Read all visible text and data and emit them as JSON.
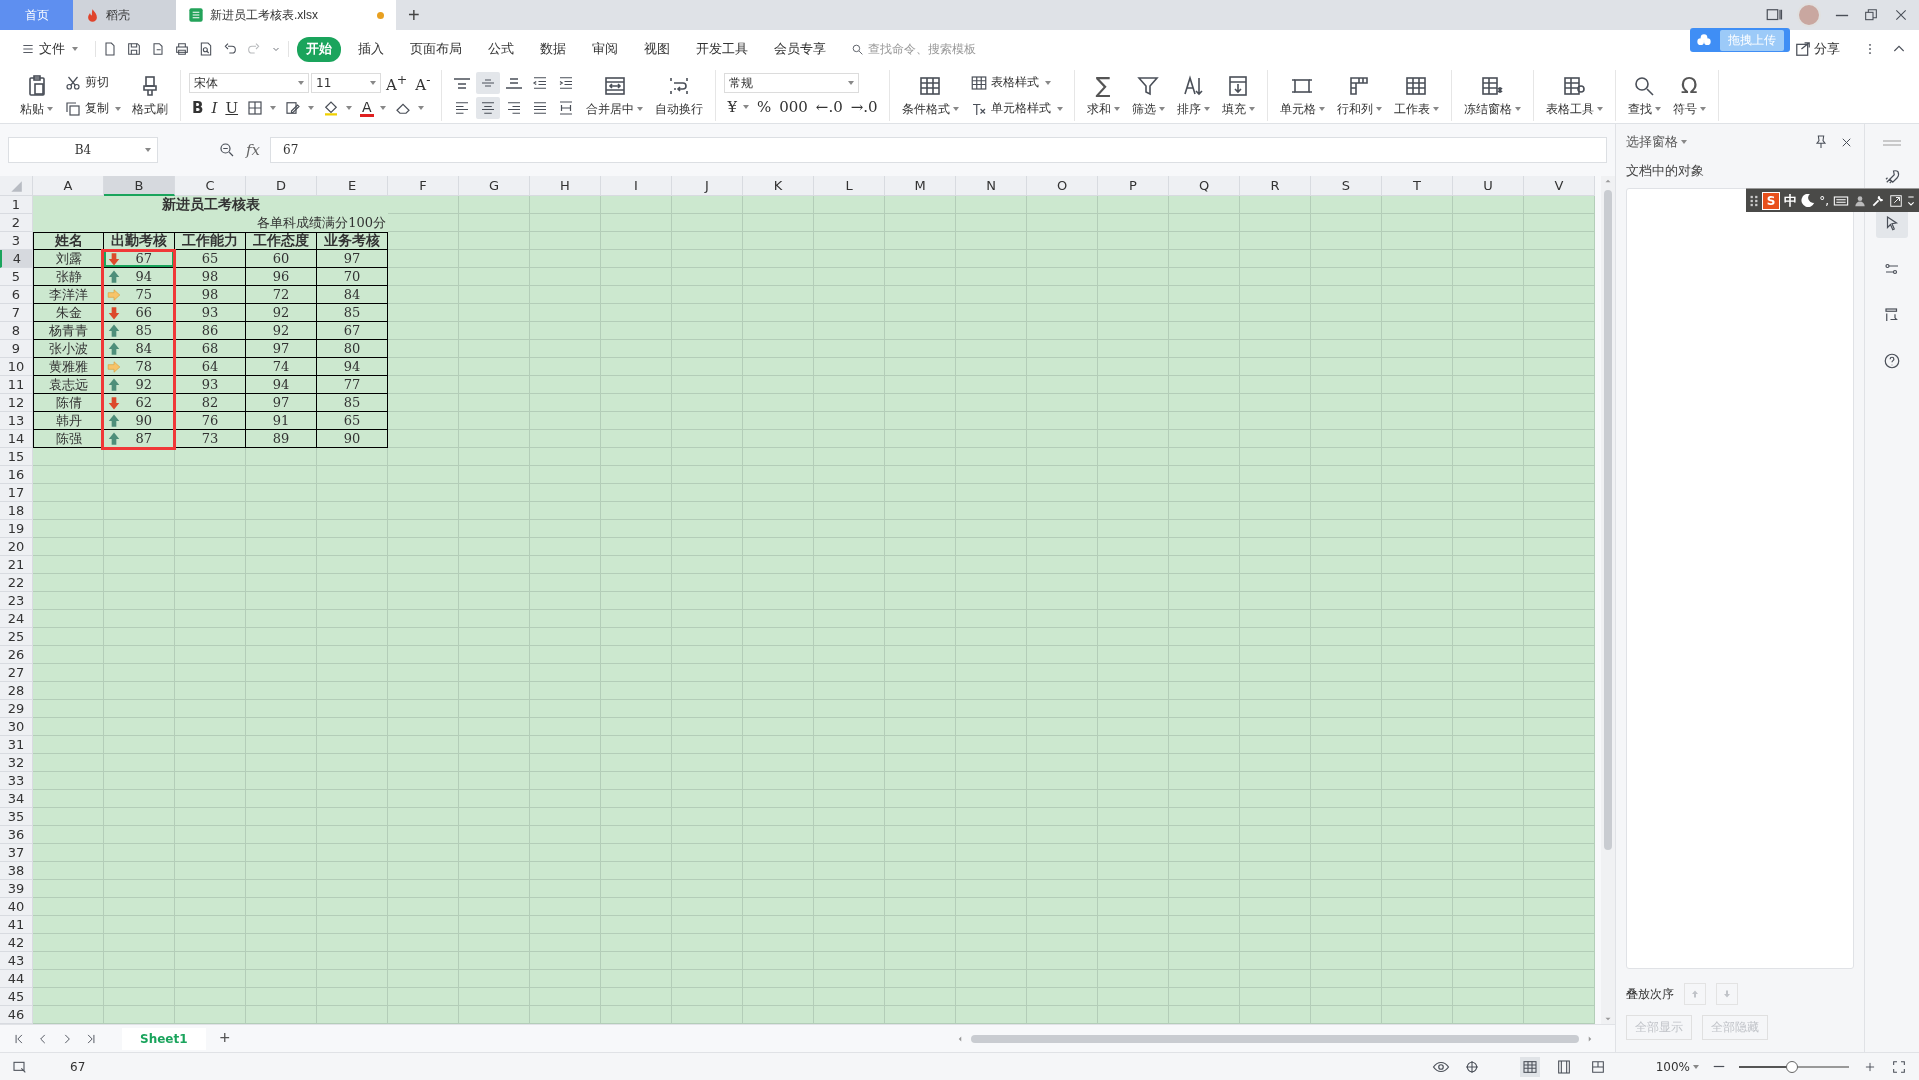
{
  "tabs": [
    {
      "label": "首页",
      "kind": "home",
      "selected": false
    },
    {
      "label": "稻壳",
      "kind": "docer",
      "selected": false
    },
    {
      "label": "新进员工考核表.xlsx",
      "kind": "workbook",
      "selected": true,
      "modified": true
    }
  ],
  "new_tab": "+",
  "menu": {
    "file": "文件",
    "tabs": [
      {
        "label": "开始",
        "selected": true
      },
      {
        "label": "插入",
        "selected": false
      },
      {
        "label": "页面布局",
        "selected": false
      },
      {
        "label": "公式",
        "selected": false
      },
      {
        "label": "数据",
        "selected": false
      },
      {
        "label": "审阅",
        "selected": false
      },
      {
        "label": "视图",
        "selected": false
      },
      {
        "label": "开发工具",
        "selected": false
      },
      {
        "label": "会员专享",
        "selected": false
      }
    ],
    "search": {
      "placeholder": "查找命令、搜索模板"
    },
    "upload_popup": "拖拽上传",
    "share": "分享"
  },
  "ribbon": [
    {
      "blocks": [
        {
          "kind": "big",
          "item": {
            "kind": "paste",
            "label": "粘贴",
            "dropdown": true
          }
        },
        {
          "kind": "stack",
          "items": [
            {
              "kind": "cut",
              "label": "剪切"
            },
            {
              "kind": "copy",
              "label": "复制",
              "dropdown": true
            }
          ]
        },
        {
          "kind": "big",
          "item": {
            "kind": "brush",
            "label": "格式刷"
          }
        }
      ]
    },
    {
      "blocks": [
        {
          "kind": "rows",
          "rows": [
            {
              "items": [
                {
                  "kind": "font-select",
                  "value": "宋体"
                },
                {
                  "kind": "size-select",
                  "value": "11"
                },
                {
                  "kind": "glyph",
                  "text": "A$^{+}$"
                },
                {
                  "kind": "glyph",
                  "text": "A$^{-}$"
                }
              ]
            },
            {
              "items": [
                {
                  "kind": "bold",
                  "text": "B"
                },
                {
                  "kind": "italic",
                  "text": "I"
                },
                {
                  "kind": "underline",
                  "text": "U"
                },
                {
                  "kind": "border",
                  "dropdown": true
                },
                {
                  "kind": "cellformat",
                  "dropdown": true
                },
                {
                  "kind": "fill",
                  "dropdown": true
                },
                {
                  "kind": "fontcolor",
                  "text": "A",
                  "dropdown": true
                },
                {
                  "kind": "eraser",
                  "dropdown": true
                }
              ]
            }
          ]
        }
      ]
    },
    {
      "blocks": [
        {
          "kind": "rows",
          "rows": [
            {
              "items": [
                {
                  "kind": "align-top",
                  "selected": false
                },
                {
                  "kind": "align-middle",
                  "selected": true
                },
                {
                  "kind": "align-bottom",
                  "selected": false
                },
                {
                  "kind": "indent-dec",
                  "selected": false
                },
                {
                  "kind": "indent-inc",
                  "selected": false
                }
              ]
            },
            {
              "items": [
                {
                  "kind": "align-left",
                  "selected": false
                },
                {
                  "kind": "align-center",
                  "selected": true
                },
                {
                  "kind": "align-right",
                  "selected": false
                },
                {
                  "kind": "justify",
                  "selected": false
                },
                {
                  "kind": "distributed",
                  "selected": false
                }
              ]
            }
          ]
        },
        {
          "kind": "big",
          "item": {
            "kind": "merge",
            "label": "合并居中",
            "dropdown": true
          }
        },
        {
          "kind": "big",
          "item": {
            "kind": "wrap",
            "label": "自动换行"
          }
        }
      ]
    },
    {
      "blocks": [
        {
          "kind": "rows",
          "rows": [
            {
              "items": [
                {
                  "kind": "format-select",
                  "value": "常规"
                }
              ]
            },
            {
              "items": [
                {
                  "kind": "glyph",
                  "text": "¥",
                  "dropdown": true
                },
                {
                  "kind": "glyph",
                  "text": "%"
                },
                {
                  "kind": "glyph",
                  "text": "000"
                },
                {
                  "kind": "glyph",
                  "text": "←.0"
                },
                {
                  "kind": "glyph",
                  "text": "→.0"
                }
              ]
            }
          ]
        }
      ]
    },
    {
      "blocks": [
        {
          "kind": "big",
          "item": {
            "kind": "condformat",
            "label": "条件格式",
            "dropdown": true
          }
        },
        {
          "kind": "stack",
          "items": [
            {
              "kind": "tablestyle",
              "label": "表格样式",
              "dropdown": true
            },
            {
              "kind": "cellstyle",
              "label": "单元格样式",
              "dropdown": true
            }
          ]
        }
      ]
    },
    {
      "blocks": [
        {
          "kind": "big",
          "item": {
            "kind": "glyph-big",
            "text": "∑",
            "label": "求和",
            "dropdown": true
          }
        },
        {
          "kind": "big",
          "item": {
            "kind": "filter",
            "label": "筛选",
            "dropdown": true
          }
        },
        {
          "kind": "big",
          "item": {
            "kind": "sort",
            "label": "排序",
            "dropdown": true
          }
        },
        {
          "kind": "big",
          "item": {
            "kind": "filldown",
            "label": "填充",
            "dropdown": true
          }
        }
      ]
    },
    {
      "blocks": [
        {
          "kind": "big",
          "item": {
            "kind": "cell",
            "label": "单元格",
            "dropdown": true
          }
        },
        {
          "kind": "big",
          "item": {
            "kind": "rowcol",
            "label": "行和列",
            "dropdown": true
          }
        },
        {
          "kind": "big",
          "item": {
            "kind": "sheet",
            "label": "工作表",
            "dropdown": true
          }
        }
      ]
    },
    {
      "blocks": [
        {
          "kind": "big",
          "item": {
            "kind": "freeze",
            "label": "冻结窗格",
            "dropdown": true
          }
        }
      ]
    },
    {
      "blocks": [
        {
          "kind": "big",
          "item": {
            "kind": "tools",
            "label": "表格工具",
            "dropdown": true
          }
        }
      ]
    },
    {
      "blocks": [
        {
          "kind": "big",
          "item": {
            "kind": "find",
            "label": "查找",
            "dropdown": true
          }
        },
        {
          "kind": "big",
          "item": {
            "kind": "glyph-big",
            "text": "Ω",
            "label": "符号",
            "dropdown": true
          }
        }
      ]
    }
  ],
  "formula_bar": {
    "name_box": "B4",
    "fx": "fx",
    "value": "67"
  },
  "sheet": {
    "columns": [
      {
        "label": "A",
        "selected": false
      },
      {
        "label": "B",
        "selected": true
      },
      {
        "label": "C",
        "selected": false
      },
      {
        "label": "D",
        "selected": false
      },
      {
        "label": "E",
        "selected": false
      },
      {
        "label": "F",
        "selected": false
      },
      {
        "label": "G",
        "selected": false
      },
      {
        "label": "H",
        "selected": false
      },
      {
        "label": "I",
        "selected": false
      },
      {
        "label": "J",
        "selected": false
      },
      {
        "label": "K",
        "selected": false
      },
      {
        "label": "L",
        "selected": false
      },
      {
        "label": "M",
        "selected": false
      },
      {
        "label": "N",
        "selected": false
      },
      {
        "label": "O",
        "selected": false
      },
      {
        "label": "P",
        "selected": false
      },
      {
        "label": "Q",
        "selected": false
      },
      {
        "label": "R",
        "selected": false
      },
      {
        "label": "S",
        "selected": false
      },
      {
        "label": "T",
        "selected": false
      },
      {
        "label": "U",
        "selected": false
      },
      {
        "label": "V",
        "selected": false
      }
    ],
    "rows": [
      {
        "label": "1",
        "selected": false
      },
      {
        "label": "2",
        "selected": false
      },
      {
        "label": "3",
        "selected": false
      },
      {
        "label": "4",
        "selected": true
      },
      {
        "label": "5",
        "selected": false
      },
      {
        "label": "6",
        "selected": false
      },
      {
        "label": "7",
        "selected": false
      },
      {
        "label": "8",
        "selected": false
      },
      {
        "label": "9",
        "selected": false
      },
      {
        "label": "10",
        "selected": false
      },
      {
        "label": "11",
        "selected": false
      },
      {
        "label": "12",
        "selected": false
      },
      {
        "label": "13",
        "selected": false
      },
      {
        "label": "14",
        "selected": false
      },
      {
        "label": "15",
        "selected": false
      },
      {
        "label": "16",
        "selected": false
      },
      {
        "label": "17",
        "selected": false
      },
      {
        "label": "18",
        "selected": false
      },
      {
        "label": "19",
        "selected": false
      },
      {
        "label": "20",
        "selected": false
      },
      {
        "label": "21",
        "selected": false
      },
      {
        "label": "22",
        "selected": false
      },
      {
        "label": "23",
        "selected": false
      },
      {
        "label": "24",
        "selected": false
      },
      {
        "label": "25",
        "selected": false
      },
      {
        "label": "26",
        "selected": false
      },
      {
        "label": "27",
        "selected": false
      },
      {
        "label": "28",
        "selected": false
      },
      {
        "label": "29",
        "selected": false
      },
      {
        "label": "30",
        "selected": false
      },
      {
        "label": "31",
        "selected": false
      },
      {
        "label": "32",
        "selected": false
      },
      {
        "label": "33",
        "selected": false
      },
      {
        "label": "34",
        "selected": false
      },
      {
        "label": "35",
        "selected": false
      },
      {
        "label": "36",
        "selected": false
      },
      {
        "label": "37",
        "selected": false
      },
      {
        "label": "38",
        "selected": false
      },
      {
        "label": "39",
        "selected": false
      },
      {
        "label": "40",
        "selected": false
      },
      {
        "label": "41",
        "selected": false
      },
      {
        "label": "42",
        "selected": false
      },
      {
        "label": "43",
        "selected": false
      },
      {
        "label": "44",
        "selected": false
      },
      {
        "label": "45",
        "selected": false
      },
      {
        "label": "46",
        "selected": false
      }
    ],
    "title": "新进员工考核表",
    "subtitle": "各单科成绩满分100分",
    "header": [
      "姓名",
      "出勤考核",
      "工作能力",
      "工作态度",
      "业务考核"
    ],
    "records": [
      {
        "name": "刘露",
        "attendance": "67",
        "kind": "down",
        "ability": "65",
        "attitude": "60",
        "business": "97"
      },
      {
        "name": "张静",
        "attendance": "94",
        "kind": "up",
        "ability": "98",
        "attitude": "96",
        "business": "70"
      },
      {
        "name": "李洋洋",
        "attendance": "75",
        "kind": "right",
        "ability": "98",
        "attitude": "72",
        "business": "84"
      },
      {
        "name": "朱金",
        "attendance": "66",
        "kind": "down",
        "ability": "93",
        "attitude": "92",
        "business": "85"
      },
      {
        "name": "杨青青",
        "attendance": "85",
        "kind": "up",
        "ability": "86",
        "attitude": "92",
        "business": "67"
      },
      {
        "name": "张小波",
        "attendance": "84",
        "kind": "up",
        "ability": "68",
        "attitude": "97",
        "business": "80"
      },
      {
        "name": "黄雅雅",
        "attendance": "78",
        "kind": "right",
        "ability": "64",
        "attitude": "74",
        "business": "94"
      },
      {
        "name": "袁志远",
        "attendance": "92",
        "kind": "up",
        "ability": "93",
        "attitude": "94",
        "business": "77"
      },
      {
        "name": "陈倩",
        "attendance": "62",
        "kind": "down",
        "ability": "82",
        "attitude": "97",
        "business": "85"
      },
      {
        "name": "韩丹",
        "attendance": "90",
        "kind": "up",
        "ability": "76",
        "attitude": "91",
        "business": "65"
      },
      {
        "name": "陈强",
        "attendance": "87",
        "kind": "up",
        "ability": "73",
        "attitude": "89",
        "business": "90"
      }
    ],
    "highlight_frame": true
  },
  "sheet_tabs": [
    {
      "label": "Sheet1",
      "selected": true
    }
  ],
  "add_sheet": "+",
  "selection_pane": {
    "title": "选择窗格",
    "objects_label": "文档中的对象",
    "order_label": "叠放次序",
    "buttons": [
      {
        "label": "全部显示",
        "disabled": true
      },
      {
        "label": "全部隐藏",
        "disabled": true
      }
    ]
  },
  "side_tools": [
    {
      "kind": "rocket",
      "selected": false
    },
    {
      "kind": "pointer",
      "selected": true
    },
    {
      "kind": "sliders",
      "selected": false
    },
    {
      "kind": "swap",
      "selected": false
    },
    {
      "kind": "help",
      "selected": false
    }
  ],
  "ime": {
    "logo": "S",
    "mode": "中",
    "punctuation": "°,"
  },
  "status": {
    "value": "67",
    "views": [
      {
        "kind": "normal",
        "selected": true
      },
      {
        "kind": "layout",
        "selected": false
      },
      {
        "kind": "break",
        "selected": false
      }
    ],
    "zoom": "100%",
    "zoom_slider": {
      "level": 0.48
    }
  }
}
